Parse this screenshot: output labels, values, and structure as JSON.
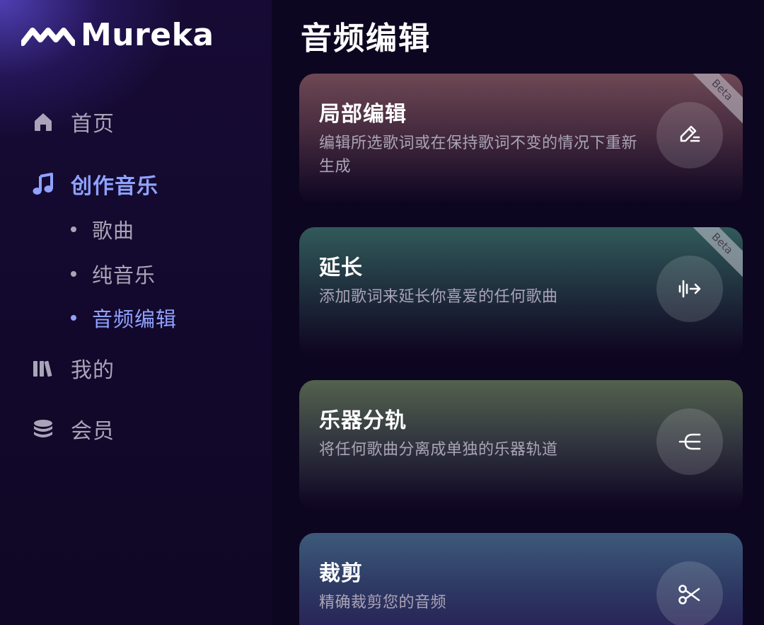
{
  "app": {
    "logo_text": "Mureka"
  },
  "sidebar": {
    "items": [
      {
        "label": "首页",
        "icon": "home-icon",
        "active": false
      },
      {
        "label": "创作音乐",
        "icon": "music-note-icon",
        "active": true
      },
      {
        "label": "我的",
        "icon": "library-icon",
        "active": false
      },
      {
        "label": "会员",
        "icon": "coins-icon",
        "active": false
      }
    ],
    "sub_items": [
      {
        "label": "歌曲",
        "active": false
      },
      {
        "label": "纯音乐",
        "active": false
      },
      {
        "label": "音频编辑",
        "active": true
      }
    ]
  },
  "main": {
    "title": "音频编辑",
    "cards": [
      {
        "title": "局部编辑",
        "desc": "编辑所选歌词或在保持歌词不变的情况下重新生成",
        "badge": "Beta",
        "icon": "edit-icon"
      },
      {
        "title": "延长",
        "desc": "添加歌词来延长你喜爱的任何歌曲",
        "badge": "Beta",
        "icon": "extend-icon"
      },
      {
        "title": "乐器分轨",
        "desc": "将任何歌曲分离成单独的乐器轨道",
        "icon": "split-tracks-icon"
      },
      {
        "title": "裁剪",
        "desc": "精确裁剪您的音频",
        "icon": "scissors-icon"
      }
    ]
  },
  "colors": {
    "accent": "#8fa2ff",
    "background": "#0d0620",
    "muted_text": "#a9a4b8"
  }
}
